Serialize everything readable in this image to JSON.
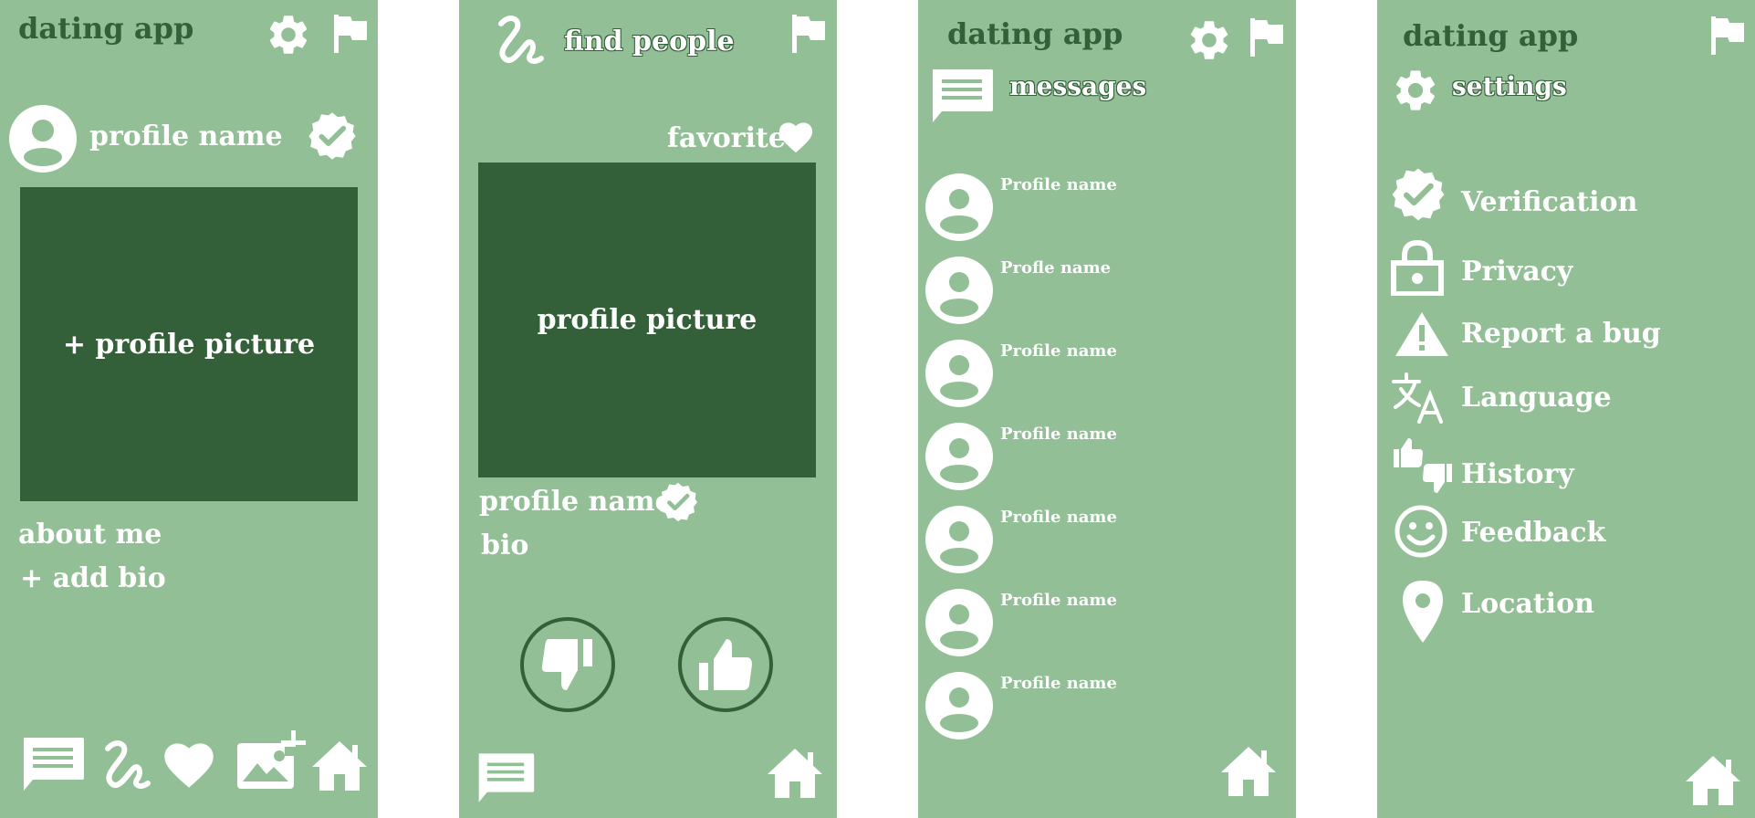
{
  "colors": {
    "panel_bg": "#93bf96",
    "dark_green": "#336039",
    "white": "#ffffff"
  },
  "screen1": {
    "app_title": "dating app",
    "icons": [
      "gear-icon",
      "flag-icon",
      "avatar-icon",
      "verified-badge-icon",
      "chat-icon",
      "squiggle-icon",
      "heart-icon",
      "add-photo-icon",
      "home-icon"
    ],
    "profile_name": "profile name",
    "add_picture_label": "+ profile picture",
    "about_me_label": "about me",
    "add_bio_label": "+ add bio"
  },
  "screen2": {
    "title": "find people",
    "favorite_label": "favorite",
    "picture_label": "profile picture",
    "profile_name": "profile name",
    "bio_label": "bio",
    "icons": [
      "squiggle-icon",
      "flag-icon",
      "heart-icon",
      "verified-badge-icon",
      "thumbs-down-icon",
      "thumbs-up-icon",
      "chat-icon",
      "home-icon"
    ]
  },
  "screen3": {
    "app_title": "dating app",
    "section_title": "messages",
    "conversations": [
      {
        "name": "Profile name"
      },
      {
        "name": "Profle name"
      },
      {
        "name": "Profile name"
      },
      {
        "name": "Profile name"
      },
      {
        "name": "Profile name"
      },
      {
        "name": "Profile name"
      },
      {
        "name": "Profile name"
      }
    ],
    "icons": [
      "gear-icon",
      "flag-icon",
      "chat-icon",
      "avatar-icon",
      "home-icon"
    ]
  },
  "screen4": {
    "app_title": "dating app",
    "section_title": "settings",
    "items": [
      {
        "label": "Verification",
        "icon": "verified-badge-icon"
      },
      {
        "label": "Privacy",
        "icon": "lock-icon"
      },
      {
        "label": "Report a bug",
        "icon": "warning-icon"
      },
      {
        "label": "Language",
        "icon": "translate-icon"
      },
      {
        "label": "History",
        "icon": "thumbs-history-icon"
      },
      {
        "label": "Feedback",
        "icon": "smiley-icon"
      },
      {
        "label": "Location",
        "icon": "location-pin-icon"
      }
    ],
    "icons": [
      "flag-icon",
      "gear-icon",
      "home-icon"
    ]
  }
}
